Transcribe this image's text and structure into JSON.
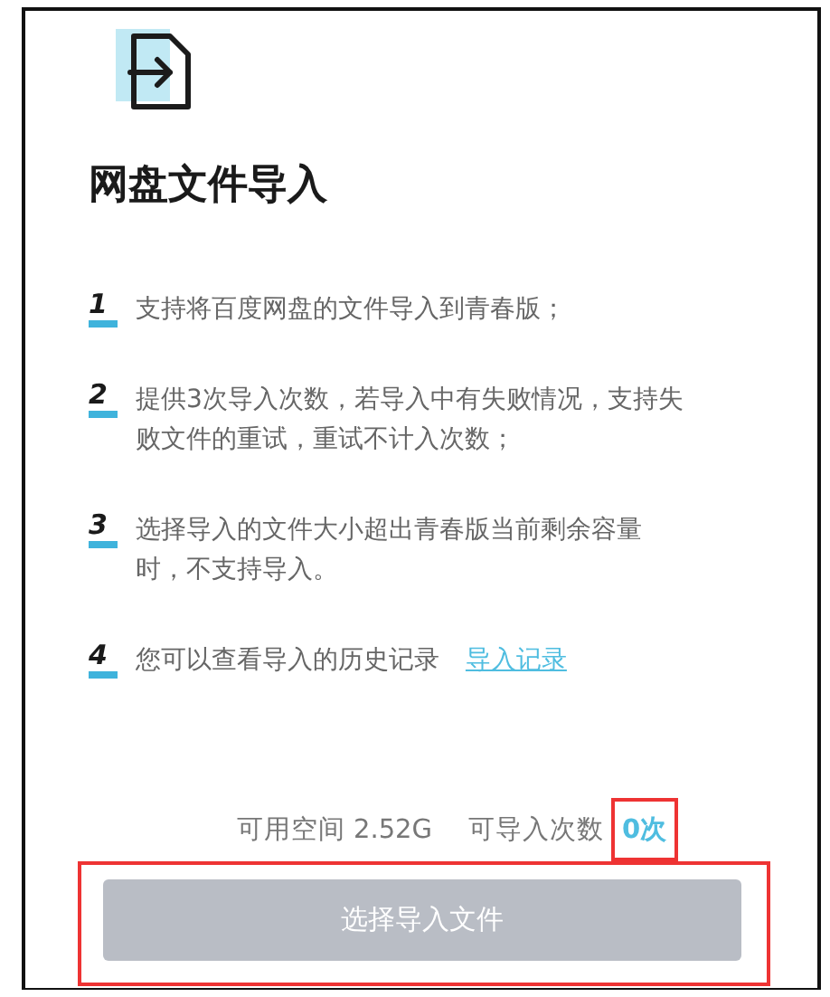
{
  "title": "网盘文件导入",
  "items": [
    {
      "number": "1",
      "text": "支持将百度网盘的文件导入到青春版；"
    },
    {
      "number": "2",
      "text": "提供3次导入次数，若导入中有失败情况，支持失败文件的重试，重试不计入次数；"
    },
    {
      "number": "3",
      "text": "选择导入的文件大小超出青春版当前剩余容量时，不支持导入。"
    },
    {
      "number": "4",
      "text": "您可以查看导入的历史记录",
      "link": "导入记录"
    }
  ],
  "stats": {
    "space": "可用空间 2.52G",
    "count_label": "可导入次数",
    "count_value": "0次",
    "count_highlighted": true
  },
  "button": {
    "label": "选择导入文件",
    "disabled": true,
    "highlighted": true
  }
}
